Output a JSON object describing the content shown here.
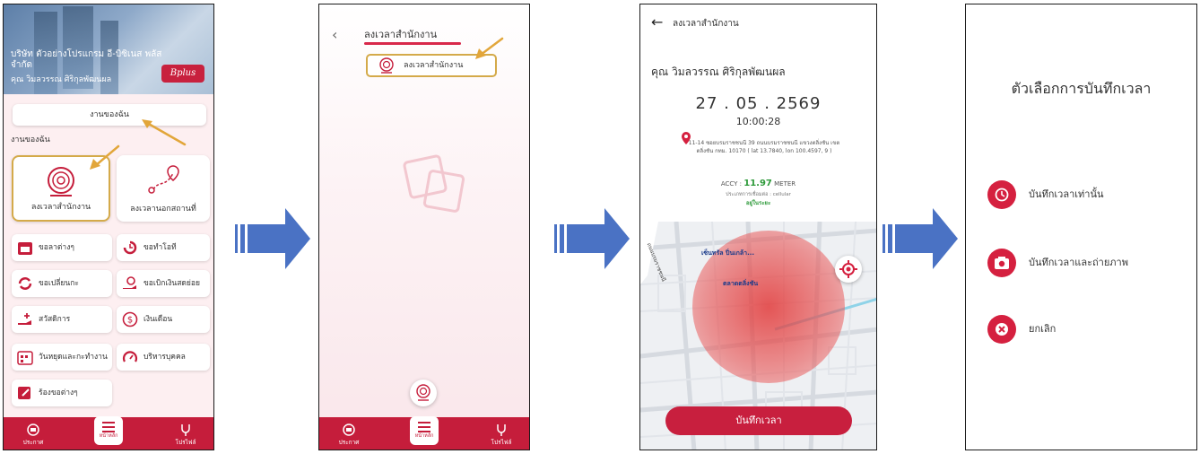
{
  "screen1": {
    "company": "บริษัท ตัวอย่างโปรแกรม อี-บิซิเนส พลัส จำกัด",
    "user": "คุณ วิมลวรรณ ศิริกุลพัฒนผล",
    "logo_text": "Bplus",
    "my_work_button": "งานของฉัน",
    "section_title": "งานของฉัน",
    "tiles": [
      {
        "label": "ลงเวลาสำนักงาน",
        "icon": "fingerprint-location-icon"
      },
      {
        "label": "ลงเวลานอกสถานที่",
        "icon": "route-pin-icon"
      }
    ],
    "menu": [
      {
        "label": "ขอลาต่างๆ",
        "icon": "calendar-icon"
      },
      {
        "label": "ขอทำโอที",
        "icon": "clock-arrow-icon"
      },
      {
        "label": "ขอเปลี่ยนกะ",
        "icon": "swap-icon"
      },
      {
        "label": "ขอเบิกเงินสดย่อย",
        "icon": "hand-money-icon"
      },
      {
        "label": "สวัสดิการ",
        "icon": "benefit-icon"
      },
      {
        "label": "เงินเดือน",
        "icon": "dollar-icon"
      },
      {
        "label": "วันหยุดและกะทำงาน",
        "icon": "calendar-grid-icon"
      },
      {
        "label": "บริหารบุคคล",
        "icon": "gauge-icon"
      },
      {
        "label": "ร้องขอต่างๆ",
        "icon": "edit-icon"
      }
    ],
    "nav": {
      "left": "ประกาศ",
      "center": "หน้าหลัก",
      "right": "โปรไฟล์"
    }
  },
  "screen2": {
    "title": "ลงเวลาสำนักงาน",
    "chip_label": "ลงเวลาสำนักงาน",
    "nav": {
      "left": "ประกาศ",
      "center": "หน้าหลัก",
      "right": "โปรไฟล์"
    }
  },
  "screen3": {
    "title": "ลงเวลาสำนักงาน",
    "name": "คุณ วิมลวรรณ ศิริกุลพัฒนผล",
    "date": "27 . 05 . 2569",
    "time": "10:00:28",
    "address": "11-14 ซอยบรมราชชนนี 39 ถนนบรมราชชนนี แขวงตลิ่งชัน เขตตลิ่งชัน กทม. 10170 ( lat 13.7840, lon 100.4597, 9 )",
    "accuracy_label": "ACCY :",
    "accuracy_value": "11.97",
    "accuracy_unit": "METER",
    "network": "ประเภทการเชื่อมต่อ : cellular",
    "in_range": "อยู่ในระยะ",
    "map_poi_1": "เซ็นทรัล ปิ่นเกล้า...",
    "map_poi_2": "ตลาดตลิ่งชัน",
    "street": "ถนนบรมราชชนนี",
    "button": "บันทึกเวลา"
  },
  "screen4": {
    "title": "ตัวเลือกการบันทึกเวลา",
    "options": [
      {
        "label": "บันทึกเวลาเท่านั้น",
        "icon": "clock-icon"
      },
      {
        "label": "บันทึกเวลาและถ่ายภาพ",
        "icon": "camera-icon"
      },
      {
        "label": "ยกเลิก",
        "icon": "close-icon"
      }
    ]
  },
  "colors": {
    "primary": "#c51d3b",
    "highlight": "#d4aa4a",
    "arrow": "#4a72c4",
    "success": "#2e9a3a"
  }
}
